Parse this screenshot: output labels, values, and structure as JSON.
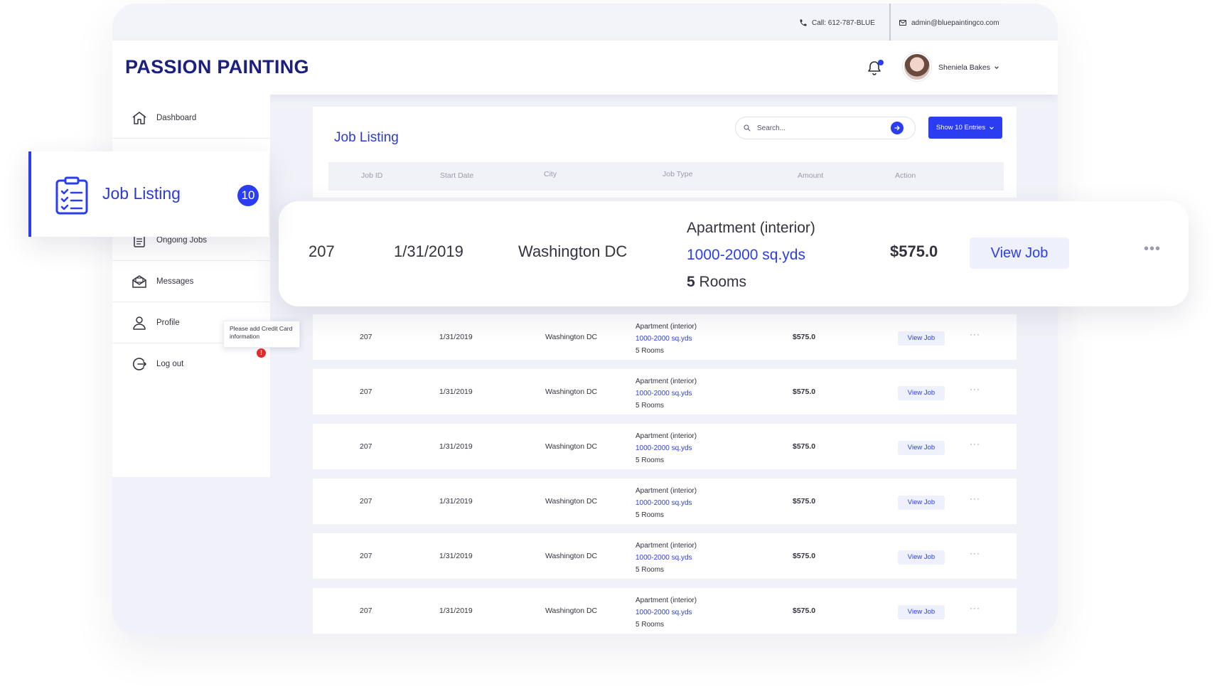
{
  "topbar": {
    "phone": "Call: 612-787-BLUE",
    "email": "admin@bluepaintingco.com"
  },
  "header": {
    "brand": "PASSION PAINTING",
    "user_name": "Sheniela Bakes"
  },
  "sidebar": {
    "items": [
      {
        "label": "Dashboard",
        "icon": "home-icon"
      },
      {
        "label": "Job Listing",
        "icon": "clipboard-list-icon",
        "badge": "10",
        "active": true
      },
      {
        "label": "Ongoing Jobs",
        "icon": "clipboard-icon"
      },
      {
        "label": "Messages",
        "icon": "envelope-icon"
      },
      {
        "label": "Profile",
        "icon": "user-icon"
      },
      {
        "label": "Log out",
        "icon": "logout-icon"
      }
    ],
    "profile_tooltip": "Please add Credit Card information",
    "profile_alert": "!"
  },
  "panel": {
    "title": "Job Listing",
    "search_placeholder": "Search...",
    "entries_label": "Show 10 Entries",
    "columns": [
      "Job ID",
      "Start Date",
      "City",
      "Job Type",
      "Amount",
      "Action"
    ]
  },
  "highlighted_row": {
    "job_id": "207",
    "start_date": "1/31/2019",
    "city": "Washington DC",
    "job_type": "Apartment (interior)",
    "size_range": "1000-2000",
    "size_unit": "sq.yds",
    "rooms_count": "5",
    "rooms_label": "Rooms",
    "amount": "$575.0",
    "action": "View Job",
    "more": "•••"
  },
  "rows": [
    {
      "job_id": "207",
      "start_date": "1/31/2019",
      "city": "Washington DC",
      "job_type": "Apartment (interior)",
      "size_range": "1000-2000",
      "size_unit": "sq.yds",
      "rooms_count": "5",
      "rooms_label": "Rooms",
      "amount": "$575.0",
      "action": "View Job",
      "more": "···"
    },
    {
      "job_id": "207",
      "start_date": "1/31/2019",
      "city": "Washington DC",
      "job_type": "Apartment (interior)",
      "size_range": "1000-2000",
      "size_unit": "sq.yds",
      "rooms_count": "5",
      "rooms_label": "Rooms",
      "amount": "$575.0",
      "action": "View Job",
      "more": "···"
    },
    {
      "job_id": "207",
      "start_date": "1/31/2019",
      "city": "Washington DC",
      "job_type": "Apartment (interior)",
      "size_range": "1000-2000",
      "size_unit": "sq.yds",
      "rooms_count": "5",
      "rooms_label": "Rooms",
      "amount": "$575.0",
      "action": "View Job",
      "more": "···"
    },
    {
      "job_id": "207",
      "start_date": "1/31/2019",
      "city": "Washington DC",
      "job_type": "Apartment (interior)",
      "size_range": "1000-2000",
      "size_unit": "sq.yds",
      "rooms_count": "5",
      "rooms_label": "Rooms",
      "amount": "$575.0",
      "action": "View Job",
      "more": "···"
    },
    {
      "job_id": "207",
      "start_date": "1/31/2019",
      "city": "Washington DC",
      "job_type": "Apartment (interior)",
      "size_range": "1000-2000",
      "size_unit": "sq.yds",
      "rooms_count": "5",
      "rooms_label": "Rooms",
      "amount": "$575.0",
      "action": "View Job",
      "more": "···"
    },
    {
      "job_id": "207",
      "start_date": "1/31/2019",
      "city": "Washington DC",
      "job_type": "Apartment (interior)",
      "size_range": "1000-2000",
      "size_unit": "sq.yds",
      "rooms_count": "5",
      "rooms_label": "Rooms",
      "amount": "$575.0",
      "action": "View Job",
      "more": "···"
    }
  ],
  "colors": {
    "brand_navy": "#1b1f7e",
    "accent_blue": "#2b3df0",
    "alert_red": "#e32a2a"
  }
}
